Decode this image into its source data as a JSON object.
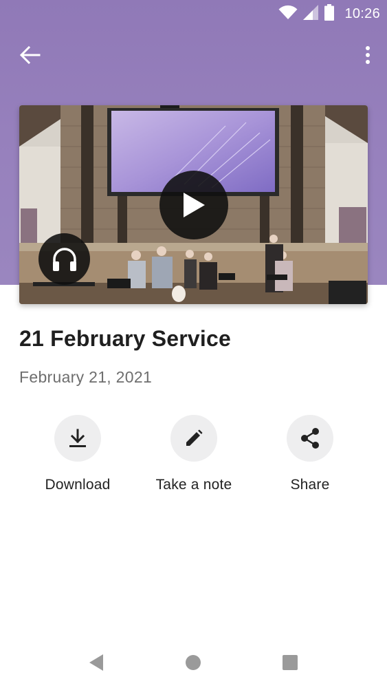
{
  "status_bar": {
    "time": "10:26",
    "icons": [
      "wifi-icon",
      "cell-signal-icon",
      "battery-icon"
    ]
  },
  "app_bar": {
    "back_icon": "arrow-back-icon",
    "menu_icon": "more-vert-icon"
  },
  "media": {
    "play_icon": "play-icon",
    "audio_icon": "headphones-icon"
  },
  "sermon": {
    "title": "21 February Service",
    "date": "February 21, 2021"
  },
  "actions": [
    {
      "label": "Download",
      "icon": "download-icon"
    },
    {
      "label": "Take a note",
      "icon": "pencil-icon"
    },
    {
      "label": "Share",
      "icon": "share-icon"
    }
  ],
  "nav_bar": {
    "icons": [
      "nav-back-icon",
      "nav-home-icon",
      "nav-recents-icon"
    ]
  },
  "colors": {
    "header": "#9781bd",
    "status_text": "#ffffff",
    "action_bg": "#eeeeef",
    "nav_icon": "#9a9a9a"
  }
}
